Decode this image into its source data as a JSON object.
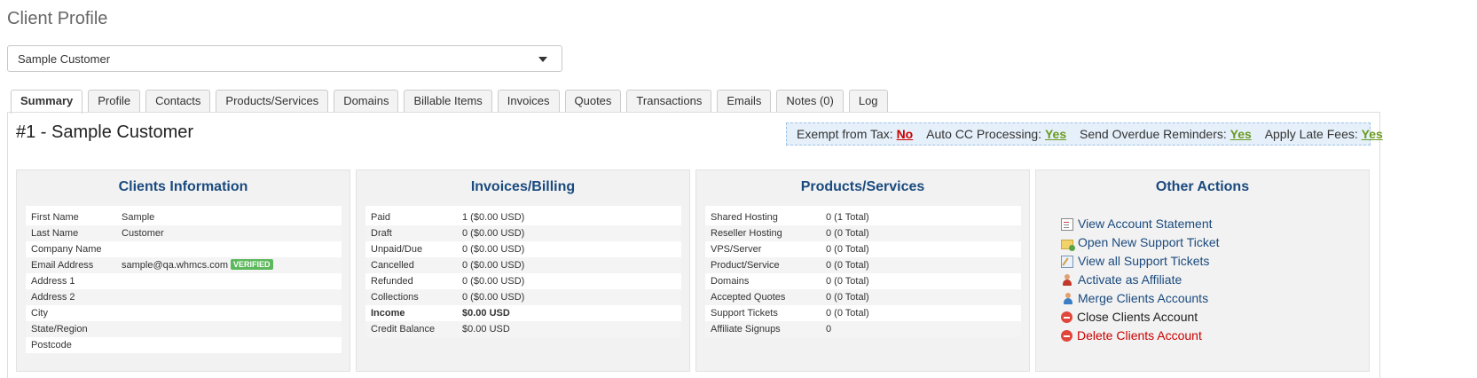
{
  "page": {
    "title": "Client Profile"
  },
  "client_select": {
    "value": "Sample Customer"
  },
  "tabs": [
    {
      "label": "Summary"
    },
    {
      "label": "Profile"
    },
    {
      "label": "Contacts"
    },
    {
      "label": "Products/Services"
    },
    {
      "label": "Domains"
    },
    {
      "label": "Billable Items"
    },
    {
      "label": "Invoices"
    },
    {
      "label": "Quotes"
    },
    {
      "label": "Transactions"
    },
    {
      "label": "Emails"
    },
    {
      "label": "Notes (0)"
    },
    {
      "label": "Log"
    }
  ],
  "client_heading": "#1 - Sample Customer",
  "flags": {
    "exempt_label": "Exempt from Tax:",
    "exempt_value": "No",
    "autocc_label": "Auto CC Processing:",
    "autocc_value": "Yes",
    "overdue_label": "Send Overdue Reminders:",
    "overdue_value": "Yes",
    "latefees_label": "Apply Late Fees:",
    "latefees_value": "Yes"
  },
  "clients_info": {
    "title": "Clients Information",
    "rows": [
      {
        "k": "First Name",
        "v": "Sample"
      },
      {
        "k": "Last Name",
        "v": "Customer"
      },
      {
        "k": "Company Name",
        "v": ""
      },
      {
        "k": "Email Address",
        "v": "sample@qa.whmcs.com"
      },
      {
        "k": "Address 1",
        "v": ""
      },
      {
        "k": "Address 2",
        "v": ""
      },
      {
        "k": "City",
        "v": ""
      },
      {
        "k": "State/Region",
        "v": ""
      },
      {
        "k": "Postcode",
        "v": ""
      }
    ],
    "verified_badge": "VERIFIED"
  },
  "billing": {
    "title": "Invoices/Billing",
    "rows": [
      {
        "k": "Paid",
        "v": "1 ($0.00 USD)"
      },
      {
        "k": "Draft",
        "v": "0 ($0.00 USD)"
      },
      {
        "k": "Unpaid/Due",
        "v": "0 ($0.00 USD)"
      },
      {
        "k": "Cancelled",
        "v": "0 ($0.00 USD)"
      },
      {
        "k": "Refunded",
        "v": "0 ($0.00 USD)"
      },
      {
        "k": "Collections",
        "v": "0 ($0.00 USD)"
      },
      {
        "k": "Income",
        "v": "$0.00 USD"
      },
      {
        "k": "Credit Balance",
        "v": "$0.00 USD"
      }
    ]
  },
  "products": {
    "title": "Products/Services",
    "rows": [
      {
        "k": "Shared Hosting",
        "v": "0 (1 Total)"
      },
      {
        "k": "Reseller Hosting",
        "v": "0 (0 Total)"
      },
      {
        "k": "VPS/Server",
        "v": "0 (0 Total)"
      },
      {
        "k": "Product/Service",
        "v": "0 (0 Total)"
      },
      {
        "k": "Domains",
        "v": "0 (0 Total)"
      },
      {
        "k": "Accepted Quotes",
        "v": "0 (0 Total)"
      },
      {
        "k": "Support Tickets",
        "v": "0 (0 Total)"
      },
      {
        "k": "Affiliate Signups",
        "v": "0"
      }
    ]
  },
  "other_actions": {
    "title": "Other Actions",
    "items": [
      {
        "label": "View Account Statement",
        "icon": "statement-icon"
      },
      {
        "label": "Open New Support Ticket",
        "icon": "new-ticket-icon"
      },
      {
        "label": "View all Support Tickets",
        "icon": "tickets-icon"
      },
      {
        "label": "Activate as Affiliate",
        "icon": "affiliate-icon"
      },
      {
        "label": "Merge Clients Accounts",
        "icon": "merge-icon"
      },
      {
        "label": "Close Clients Account",
        "icon": "close-account-icon"
      },
      {
        "label": "Delete Clients Account",
        "icon": "delete-account-icon"
      }
    ]
  }
}
